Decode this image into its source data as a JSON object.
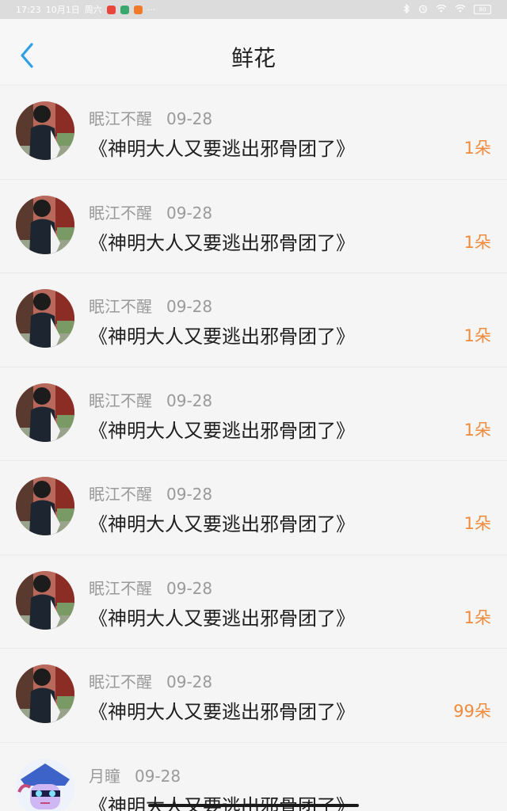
{
  "status_bar": {
    "time": "17:23",
    "date": "10月1日",
    "weekday": "周六",
    "more": "···",
    "battery": "80"
  },
  "header": {
    "title": "鲜花"
  },
  "colors": {
    "accent_blue": "#2f9fe6",
    "flower_orange": "#f08a3c"
  },
  "rows": [
    {
      "user": "眠江不醒",
      "date": "09-28",
      "book": "《神明大人又要逃出邪骨团了》",
      "flowers": "1朵",
      "avatar": "boy"
    },
    {
      "user": "眠江不醒",
      "date": "09-28",
      "book": "《神明大人又要逃出邪骨团了》",
      "flowers": "1朵",
      "avatar": "boy"
    },
    {
      "user": "眠江不醒",
      "date": "09-28",
      "book": "《神明大人又要逃出邪骨团了》",
      "flowers": "1朵",
      "avatar": "boy"
    },
    {
      "user": "眠江不醒",
      "date": "09-28",
      "book": "《神明大人又要逃出邪骨团了》",
      "flowers": "1朵",
      "avatar": "boy"
    },
    {
      "user": "眠江不醒",
      "date": "09-28",
      "book": "《神明大人又要逃出邪骨团了》",
      "flowers": "1朵",
      "avatar": "boy"
    },
    {
      "user": "眠江不醒",
      "date": "09-28",
      "book": "《神明大人又要逃出邪骨团了》",
      "flowers": "1朵",
      "avatar": "boy"
    },
    {
      "user": "眠江不醒",
      "date": "09-28",
      "book": "《神明大人又要逃出邪骨团了》",
      "flowers": "99朵",
      "avatar": "boy"
    },
    {
      "user": "月瞳",
      "date": "09-28",
      "book": "《神明大人又要逃出邪骨团了》",
      "flowers": "",
      "avatar": "anime"
    }
  ]
}
